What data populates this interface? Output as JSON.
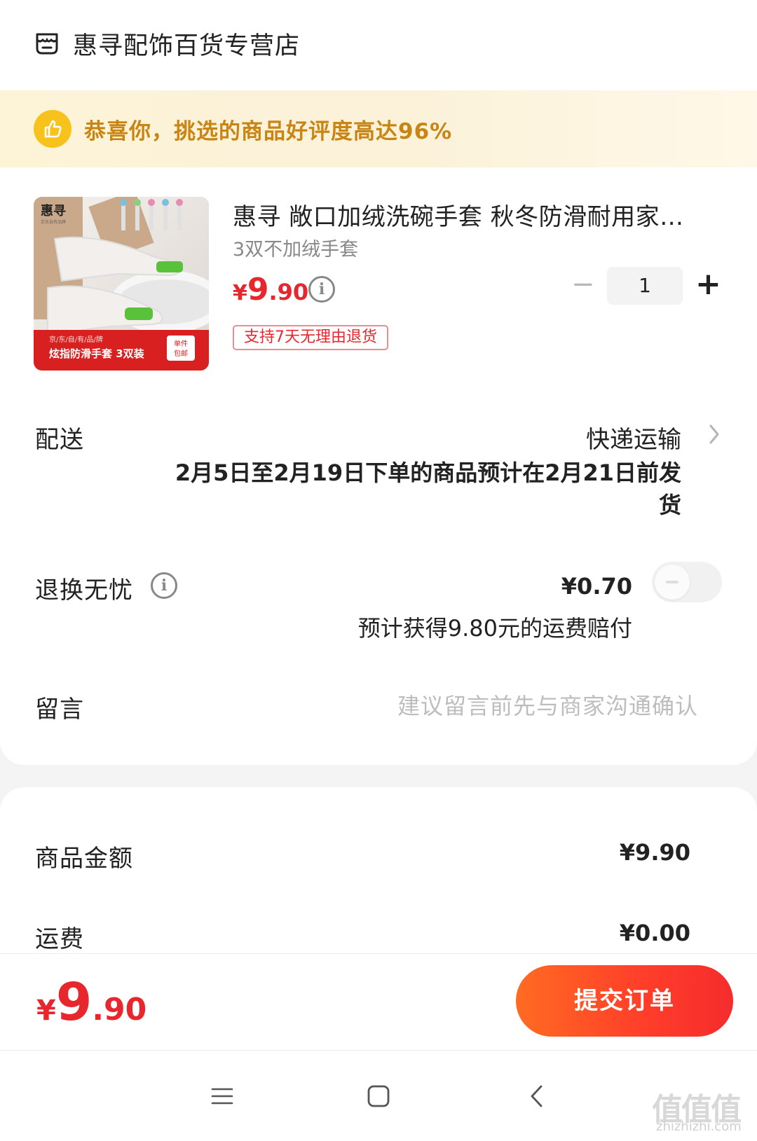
{
  "shop": {
    "name": "惠寻配饰百货专营店"
  },
  "banner": {
    "text": "恭喜你，挑选的商品好评度高达96%"
  },
  "product": {
    "title": "惠寻 敞口加绒洗碗手套 秋冬防滑耐用家…",
    "spec": "3双不加绒手套",
    "price_symbol": "¥",
    "price_int": "9",
    "price_dec": ".90",
    "return_tag": "支持7天无理由退货",
    "quantity": "1",
    "image": {
      "brand": "惠寻",
      "brand_sub": "京东自有品牌",
      "caption_small": "京/东/自/有/品/牌",
      "caption": "炫指防滑手套 3双装",
      "badge_line1": "单件",
      "badge_line2": "包邮"
    }
  },
  "delivery": {
    "label": "配送",
    "method": "快递运输",
    "note_line1": "2月5日至2月19日下单的商品预计在2月21日前发",
    "note_line2": "货"
  },
  "insurance": {
    "label": "退换无忧",
    "price": "¥0.70",
    "note": "预计获得9.80元的运费赔付",
    "enabled": false
  },
  "message": {
    "label": "留言",
    "placeholder": "建议留言前先与商家沟通确认"
  },
  "summary": {
    "goods_label": "商品金额",
    "goods_value": "¥9.90",
    "shipping_label": "运费",
    "shipping_value": "¥0.00"
  },
  "footer": {
    "total_symbol": "¥",
    "total_int": "9",
    "total_dec": ".90",
    "submit_label": "提交订单"
  },
  "watermark": {
    "text": "值值值",
    "sub": "zhizhizhi.com"
  },
  "colors": {
    "accent": "#e8262d",
    "button": "#ff4a26",
    "banner_text": "#c98513"
  }
}
